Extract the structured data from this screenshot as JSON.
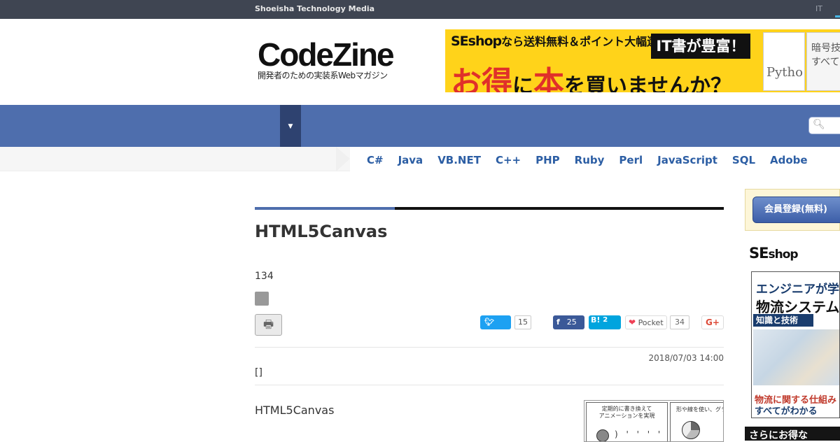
{
  "topbar": {
    "brand": "Shoeisha Technology Media",
    "right_link": "IT"
  },
  "logo": {
    "name": "CodeZine",
    "tagline": "開発者のための実装系Webマガジン"
  },
  "banner": {
    "line1_brand": "SEshop",
    "line1_text": "なら送料無料＆ポイント大幅還元",
    "tag": "IT書が豊富！",
    "line2_a": "お得",
    "line2_b": "に",
    "line2_c": "本",
    "line2_d": "を買いませんか？",
    "book1": "Pytho",
    "book2": "暗号技すべて"
  },
  "nav": {
    "dropdown_icon": "▼",
    "search_icon": "magnifier-icon"
  },
  "languages": [
    "C#",
    "Java",
    "VB.NET",
    "C++",
    "PHP",
    "Ruby",
    "Perl",
    "JavaScript",
    "SQL",
    "Adobe"
  ],
  "article": {
    "title": "HTML5Canvas",
    "count": "134",
    "print_icon": "printer-icon",
    "share": {
      "twitter_count": "15",
      "facebook_count": "25",
      "hatena_label": "B!",
      "hatena_count": "2",
      "pocket_label": "Pocket",
      "pocket_count": "34",
      "gplus_label": "G+"
    },
    "date": "2018/07/03 14:00",
    "bracket": "[]",
    "lead": "HTML5Canvas",
    "thumb": {
      "panel1_text": "定期的に書き換えて\nアニメーションを実現",
      "panel2_text": "形や線を使い、グラフ"
    }
  },
  "sidebar": {
    "register_button": "会員登録(無料)",
    "seshop_se": "SE",
    "seshop_shop": "shop",
    "book": {
      "title1": "エンジニアが学",
      "title2": "物流システム",
      "subtitle": "知識と技術",
      "caption1": "物流に関する仕組み",
      "caption2": "すべてがわかる"
    },
    "promo": "さらにお得な"
  }
}
